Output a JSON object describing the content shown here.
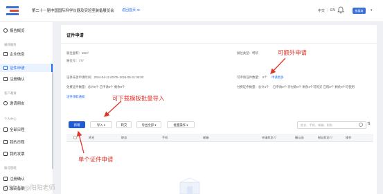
{
  "header": {
    "title": "第二十一届中国国际科学仪器及实验室装备展览会",
    "return_link": "返回首页 ≫",
    "lang_zh": "中文",
    "lang_sep": "|",
    "lang_en": "EN",
    "user_badge": "参展商",
    "user_caret": "▾"
  },
  "sidebar": {
    "items": [
      {
        "label": "报告概览",
        "icon": "report-icon"
      },
      {
        "label": "企业信息",
        "icon": "company-icon"
      },
      {
        "label": "证件申请",
        "icon": "badge-icon"
      },
      {
        "label": "注册确认",
        "icon": "register-icon"
      },
      {
        "label": "邀请朋友",
        "icon": "invite-icon"
      },
      {
        "label": "全部日程",
        "icon": "schedule-icon"
      },
      {
        "label": "我的日程",
        "icon": "calendar-icon"
      },
      {
        "label": "我的发票",
        "icon": "invoice-icon"
      },
      {
        "label": "注册确认",
        "icon": "register-icon"
      },
      {
        "label": "展商备案",
        "icon": "file-icon"
      }
    ],
    "groups": [
      "展商服务",
      "客户邀请",
      "个人中心",
      "账号管理"
    ]
  },
  "main": {
    "page_title": "证件申请",
    "booth_area": "展位面积：18m²",
    "booth_type": "展位类型：特装",
    "booth_no": "展位号：777",
    "apply_time": "证件开放申请时间：2024-04-12 00:00–2024-05-31 00:00",
    "apply_quota_label": "可申请证件数量：",
    "apply_quota_value": "8个",
    "apply_more": "申请更多",
    "free_stats": "免费证件数量：总计8个  已申请0个  剩余8个",
    "status_stats": "付费证件数量：总计4个",
    "status_items": "已申请0个   待付款0个   剩余4个可购买   已购0个   剩余0个可使用",
    "notice_link": "证件领取通知"
  },
  "toolbar": {
    "new": "新增",
    "import": "导入 ▾",
    "transfer": "转交",
    "export": "导出全部 ▾",
    "batch": "批量操作 ▾",
    "search_placeholder": "姓名、手机、邮箱、职务",
    "filter_icon": "filter-icon"
  },
  "table": {
    "headers": [
      "姓名",
      "职务",
      "手机",
      "邮箱",
      "申请状态 ▽",
      "确认函",
      "制证状态 ▽",
      "操作"
    ]
  },
  "annotations": {
    "more": "可额外申请",
    "import": "可下载模板批量导入",
    "single": "单个证件申请"
  },
  "watermark": "CSDN @阳阳老师",
  "colors": {
    "accent": "#1e6ef2",
    "annotation": "#e0342b"
  }
}
